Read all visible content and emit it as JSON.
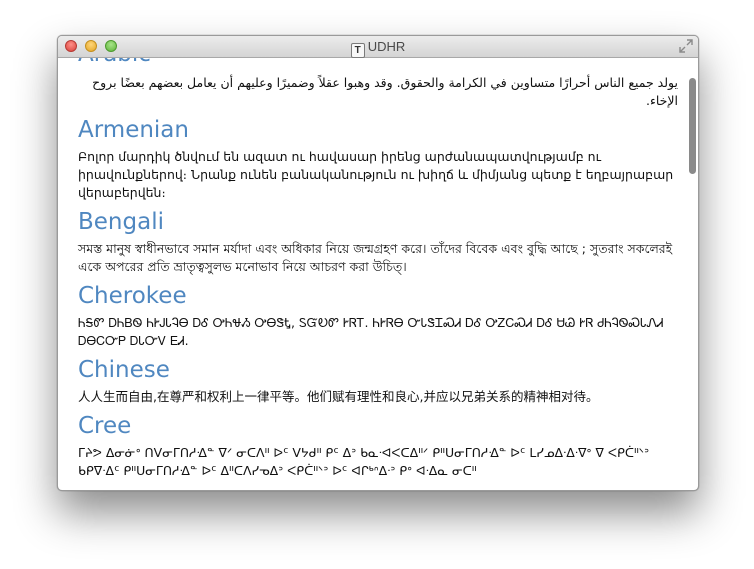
{
  "window": {
    "title": "UDHR",
    "doc_icon_letter": "T",
    "colors": {
      "heading": "#4f87c0",
      "close": "#e0443e",
      "minimize": "#e7a82b",
      "zoom": "#62ba46"
    }
  },
  "languages": [
    {
      "name": "Arabic",
      "text": "يولد جميع الناس أحرارًا متساوين في الكرامة والحقوق. وقد وهبوا عقلاً وضميرًا وعليهم أن يعامل بعضهم بعضًا بروح الإخاء."
    },
    {
      "name": "Armenian",
      "text": "Բոլոր մարդիկ ծնվում են ազատ ու հավասար իրենց արժանապատվությամբ ու իրավունքներով։ Նրանք ունեն բանականություն ու խիղճ և միմյանց պետք է եղբայրաբար վերաբերվեն։"
    },
    {
      "name": "Bengali",
      "text": "সমস্ত মানুষ স্বাধীনভাবে সমান মর্যাদা এবং অধিকার নিয়ে জন্মগ্রহণ করে। তাঁদের বিবেক এবং বুদ্ধি আছে ; সুতরাং সকলেরই একে অপরের প্রতি ভ্রাতৃত্বসুলভ মনোভাব নিয়ে আচরণ করা উচিত্।"
    },
    {
      "name": "Cherokee",
      "text": "ᏂᎦᏛ ᎠᏂᏴᏫ ᏂᎨᎫᏓᎸᎾ ᎠᎴ ᎤᏂᏠᏱ ᎤᎾᏕᎿ, ᏚᏳᎧᏛ ᎨᏒᎢ. ᏂᎨᏒᎾ ᏅᏓᏕᏆᏍᏗ ᎠᎴ ᎤᏃᏟᏍᏗ ᎠᎴ ᏌᏊ ᎨᏒ ᏧᏂᎸᏫᏍᏓᏁᏗ ᎠᎾᏟᏅᏢ ᎠᏓᏅᏙ ᎬᏗ."
    },
    {
      "name": "Chinese",
      "text": "人人生而自由,在尊严和权利上一律平等。他们赋有理性和良心,并应以兄弟关系的精神相对待。"
    },
    {
      "name": "Cree",
      "text": "ᒥᔨᕗ ᐃᓂᓃᐤ ᑎᐯᓂᒥᑎᓱᐎᓐ ᐁᐟ ᓂᑕᐱᐦ ᐅᑦ ᐯᔭᑯᐦ ᑭᑦ ᐃᐣ ᑲᓇᐧᐊᐸᑕᐃᐦᐟ ᑭᐦᑌᓂᒥᑎᓱᐎᓐ ᐅᑦ ᒪᓯᓄᐃᐧᐃᐧᐁᐤ ᐁ ᐸᑭᑖᐦᐠᐣ ᑲᑭᐁᐧᐃᑦ ᑭᐦᑌᓂᒥᑎᓱᐎᓐ ᐅᑦ ᐃᐦᑕᐱᓯᓀᐃᐣ ᐸᑭᑖᐦᐠᐣ ᐅᑦ ᐊᒋᒃᐢᐃᐧᐣ ᑭᐤ ᐊᐧᐃᓇ ᓂᑕᐦ"
    }
  ]
}
